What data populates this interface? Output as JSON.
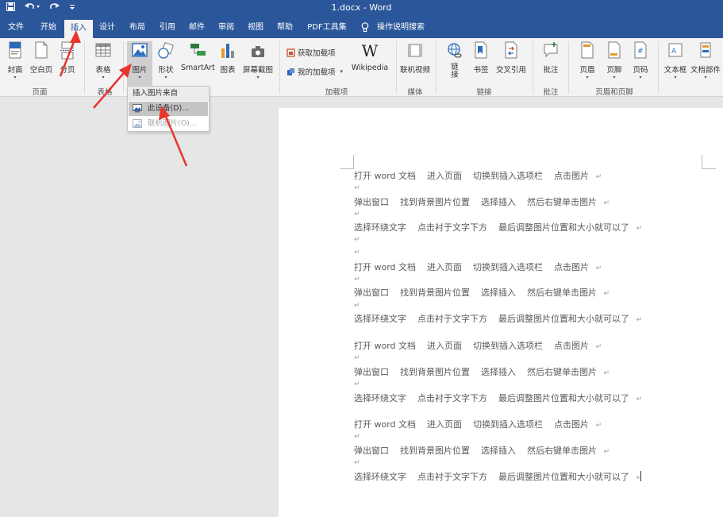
{
  "titlebar": {
    "title": "1.docx  -  Word",
    "bg_color": "#2b579a",
    "qat": [
      {
        "name": "save-icon",
        "glyph": "▣"
      },
      {
        "name": "undo-icon",
        "glyph": "↶ ▾"
      },
      {
        "name": "redo-icon",
        "glyph": "↷"
      },
      {
        "name": "customize-qat-icon",
        "glyph": "▾"
      }
    ]
  },
  "tabs": [
    {
      "label": "文件",
      "id": "file"
    },
    {
      "label": "开始",
      "id": "home"
    },
    {
      "label": "插入",
      "id": "insert",
      "active": true
    },
    {
      "label": "设计",
      "id": "design"
    },
    {
      "label": "布局",
      "id": "layout"
    },
    {
      "label": "引用",
      "id": "references"
    },
    {
      "label": "邮件",
      "id": "mailings"
    },
    {
      "label": "审阅",
      "id": "review"
    },
    {
      "label": "视图",
      "id": "view"
    },
    {
      "label": "帮助",
      "id": "help"
    },
    {
      "label": "PDF工具集",
      "id": "pdf"
    },
    {
      "label": "操作说明搜索",
      "id": "tell-me"
    }
  ],
  "ribbon": {
    "buttons": {
      "cover": "封面",
      "blank_page": "空白页",
      "page_break": "分页",
      "table": "表格",
      "pictures": "图片",
      "shapes": "形状",
      "smartart": "SmartArt",
      "chart": "图表",
      "screenshot": "屏幕截图",
      "get_addins": "获取加载项",
      "my_addins": "我的加载项",
      "wikipedia": "Wikipedia",
      "online_video": "联机视频",
      "link": "链\n接",
      "bookmark": "书签",
      "cross_ref": "交叉引用",
      "comment": "批注",
      "header": "页眉",
      "footer": "页脚",
      "page_number": "页码",
      "textbox": "文本框",
      "quick_parts": "文档部件"
    },
    "groups": {
      "pages": "页面",
      "tables": "表格",
      "addins": "加载项",
      "media": "媒体",
      "links": "链接",
      "comments": "批注",
      "header_footer": "页眉和页脚"
    }
  },
  "dropdown": {
    "header": "插入图片来自",
    "items": [
      {
        "label": "此设备(D)...",
        "state": "hover"
      },
      {
        "label": "联机图片(O)...",
        "state": "disabled"
      }
    ]
  },
  "document": {
    "lines": [
      "打开 word 文档    进入页面    切换到插入选项栏    点击图片",
      "",
      "弹出窗口    找到背景图片位置    选择插入    然后右键单击图片",
      "",
      "选择环绕文字    点击衬于文字下方    最后调整图片位置和大小就可以了",
      "",
      "",
      "打开 word 文档    进入页面    切换到插入选项栏    点击图片",
      "",
      "弹出窗口    找到背景图片位置    选择插入    然后右键单击图片",
      "",
      "选择环绕文字    点击衬于文字下方    最后调整图片位置和大小就可以了",
      "打开 word 文档    进入页面    切换到插入选项栏    点击图片",
      "",
      "弹出窗口    找到背景图片位置    选择插入    然后右键单击图片",
      "",
      "选择环绕文字    点击衬于文字下方    最后调整图片位置和大小就可以了",
      "打开 word 文档    进入页面    切换到插入选项栏    点击图片",
      "",
      "弹出窗口    找到背景图片位置    选择插入    然后右键单击图片",
      "",
      "选择环绕文字    点击衬于文字下方    最后调整图片位置和大小就可以了"
    ],
    "paragraph_mark": "↵"
  },
  "colors": {
    "accent": "#2b579a",
    "annotation_arrow": "#e8352e"
  }
}
